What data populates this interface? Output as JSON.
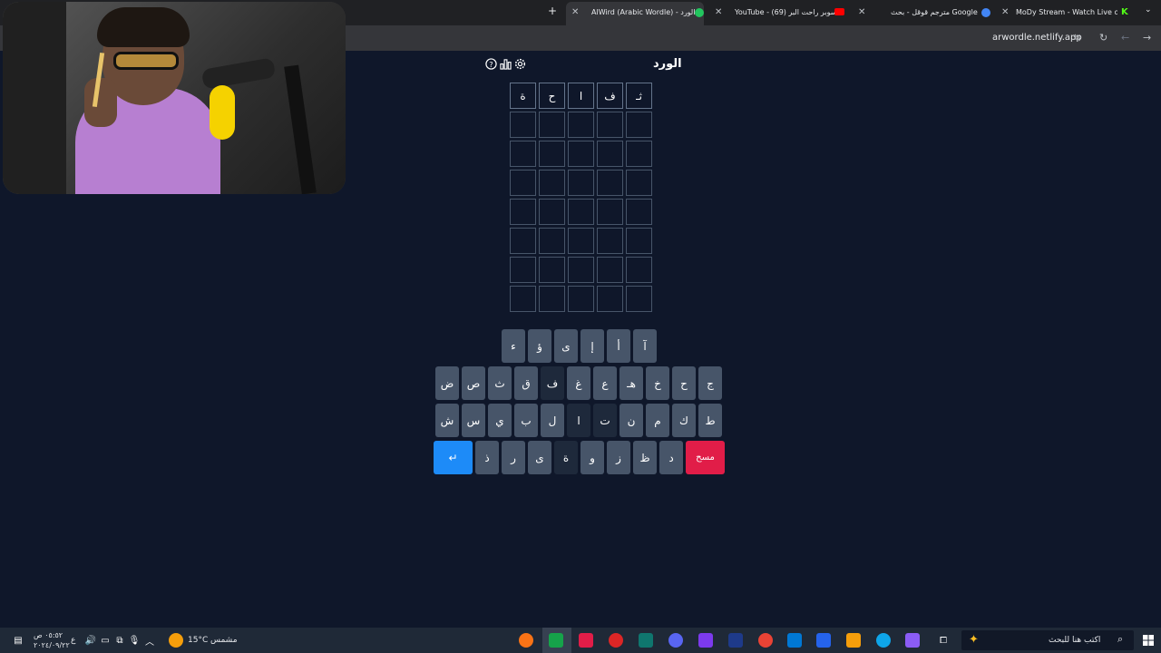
{
  "browser": {
    "tabs": [
      {
        "title": "MoDy Stream - Watch Live on K",
        "favicon_color": "#53fc18"
      },
      {
        "title": "مترجم قوقل - بحث Google",
        "favicon_color": "#4285f4"
      },
      {
        "title": "YouTube - (69) سوبر راحت البر",
        "favicon_color": "#ff0000"
      },
      {
        "title": "AlWird (Arabic Wordle) - الورد",
        "favicon_color": "#22c55e"
      }
    ],
    "new_tab_label": "+",
    "url": "arwordle.netlify.app"
  },
  "game": {
    "title": "الورد",
    "icons": [
      "help-icon",
      "stats-icon",
      "settings-icon"
    ],
    "rows": [
      [
        "ثـ",
        "ف",
        "ا",
        "ح",
        "ة"
      ],
      [
        "",
        "",
        "",
        "",
        ""
      ],
      [
        "",
        "",
        "",
        "",
        ""
      ],
      [
        "",
        "",
        "",
        "",
        ""
      ],
      [
        "",
        "",
        "",
        "",
        ""
      ],
      [
        "",
        "",
        "",
        "",
        ""
      ],
      [
        "",
        "",
        "",
        "",
        ""
      ],
      [
        "",
        "",
        "",
        "",
        ""
      ]
    ],
    "keyboard": {
      "row1": [
        "آ",
        "أ",
        "إ",
        "ى",
        "ؤ",
        "ء"
      ],
      "row2": [
        "ج",
        "ح",
        "خ",
        "هـ",
        "ع",
        "غ",
        "ف",
        "ق",
        "ث",
        "ص",
        "ض"
      ],
      "row3": [
        "ط",
        "ك",
        "م",
        "ن",
        "ت",
        "ا",
        "ل",
        "ب",
        "ي",
        "س",
        "ش"
      ],
      "row4": [
        "د",
        "ظ",
        "ز",
        "و",
        "ة",
        "ى",
        "ر",
        "ذ"
      ],
      "delete_label": "مسح",
      "enter_label": "↵"
    },
    "used_keys": [
      "ف",
      "ا",
      "ت",
      "ة",
      "ق"
    ]
  },
  "taskbar": {
    "search_placeholder": "اكتب هنا للبحث",
    "weather_temp": "15°C",
    "weather_label": "مشمس",
    "time": "٠٥:٥٢ ص",
    "date": "٢٠٢٤/٠٩/٢٢",
    "lang": "ع"
  }
}
